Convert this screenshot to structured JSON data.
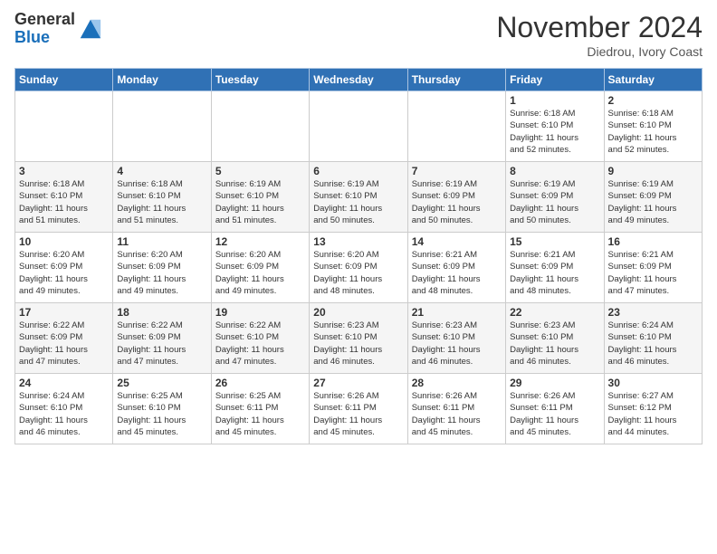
{
  "logo": {
    "general": "General",
    "blue": "Blue"
  },
  "header": {
    "month": "November 2024",
    "location": "Diedrou, Ivory Coast"
  },
  "weekdays": [
    "Sunday",
    "Monday",
    "Tuesday",
    "Wednesday",
    "Thursday",
    "Friday",
    "Saturday"
  ],
  "weeks": [
    [
      {
        "day": "",
        "info": ""
      },
      {
        "day": "",
        "info": ""
      },
      {
        "day": "",
        "info": ""
      },
      {
        "day": "",
        "info": ""
      },
      {
        "day": "",
        "info": ""
      },
      {
        "day": "1",
        "info": "Sunrise: 6:18 AM\nSunset: 6:10 PM\nDaylight: 11 hours\nand 52 minutes."
      },
      {
        "day": "2",
        "info": "Sunrise: 6:18 AM\nSunset: 6:10 PM\nDaylight: 11 hours\nand 52 minutes."
      }
    ],
    [
      {
        "day": "3",
        "info": "Sunrise: 6:18 AM\nSunset: 6:10 PM\nDaylight: 11 hours\nand 51 minutes."
      },
      {
        "day": "4",
        "info": "Sunrise: 6:18 AM\nSunset: 6:10 PM\nDaylight: 11 hours\nand 51 minutes."
      },
      {
        "day": "5",
        "info": "Sunrise: 6:19 AM\nSunset: 6:10 PM\nDaylight: 11 hours\nand 51 minutes."
      },
      {
        "day": "6",
        "info": "Sunrise: 6:19 AM\nSunset: 6:10 PM\nDaylight: 11 hours\nand 50 minutes."
      },
      {
        "day": "7",
        "info": "Sunrise: 6:19 AM\nSunset: 6:09 PM\nDaylight: 11 hours\nand 50 minutes."
      },
      {
        "day": "8",
        "info": "Sunrise: 6:19 AM\nSunset: 6:09 PM\nDaylight: 11 hours\nand 50 minutes."
      },
      {
        "day": "9",
        "info": "Sunrise: 6:19 AM\nSunset: 6:09 PM\nDaylight: 11 hours\nand 49 minutes."
      }
    ],
    [
      {
        "day": "10",
        "info": "Sunrise: 6:20 AM\nSunset: 6:09 PM\nDaylight: 11 hours\nand 49 minutes."
      },
      {
        "day": "11",
        "info": "Sunrise: 6:20 AM\nSunset: 6:09 PM\nDaylight: 11 hours\nand 49 minutes."
      },
      {
        "day": "12",
        "info": "Sunrise: 6:20 AM\nSunset: 6:09 PM\nDaylight: 11 hours\nand 49 minutes."
      },
      {
        "day": "13",
        "info": "Sunrise: 6:20 AM\nSunset: 6:09 PM\nDaylight: 11 hours\nand 48 minutes."
      },
      {
        "day": "14",
        "info": "Sunrise: 6:21 AM\nSunset: 6:09 PM\nDaylight: 11 hours\nand 48 minutes."
      },
      {
        "day": "15",
        "info": "Sunrise: 6:21 AM\nSunset: 6:09 PM\nDaylight: 11 hours\nand 48 minutes."
      },
      {
        "day": "16",
        "info": "Sunrise: 6:21 AM\nSunset: 6:09 PM\nDaylight: 11 hours\nand 47 minutes."
      }
    ],
    [
      {
        "day": "17",
        "info": "Sunrise: 6:22 AM\nSunset: 6:09 PM\nDaylight: 11 hours\nand 47 minutes."
      },
      {
        "day": "18",
        "info": "Sunrise: 6:22 AM\nSunset: 6:09 PM\nDaylight: 11 hours\nand 47 minutes."
      },
      {
        "day": "19",
        "info": "Sunrise: 6:22 AM\nSunset: 6:10 PM\nDaylight: 11 hours\nand 47 minutes."
      },
      {
        "day": "20",
        "info": "Sunrise: 6:23 AM\nSunset: 6:10 PM\nDaylight: 11 hours\nand 46 minutes."
      },
      {
        "day": "21",
        "info": "Sunrise: 6:23 AM\nSunset: 6:10 PM\nDaylight: 11 hours\nand 46 minutes."
      },
      {
        "day": "22",
        "info": "Sunrise: 6:23 AM\nSunset: 6:10 PM\nDaylight: 11 hours\nand 46 minutes."
      },
      {
        "day": "23",
        "info": "Sunrise: 6:24 AM\nSunset: 6:10 PM\nDaylight: 11 hours\nand 46 minutes."
      }
    ],
    [
      {
        "day": "24",
        "info": "Sunrise: 6:24 AM\nSunset: 6:10 PM\nDaylight: 11 hours\nand 46 minutes."
      },
      {
        "day": "25",
        "info": "Sunrise: 6:25 AM\nSunset: 6:10 PM\nDaylight: 11 hours\nand 45 minutes."
      },
      {
        "day": "26",
        "info": "Sunrise: 6:25 AM\nSunset: 6:11 PM\nDaylight: 11 hours\nand 45 minutes."
      },
      {
        "day": "27",
        "info": "Sunrise: 6:26 AM\nSunset: 6:11 PM\nDaylight: 11 hours\nand 45 minutes."
      },
      {
        "day": "28",
        "info": "Sunrise: 6:26 AM\nSunset: 6:11 PM\nDaylight: 11 hours\nand 45 minutes."
      },
      {
        "day": "29",
        "info": "Sunrise: 6:26 AM\nSunset: 6:11 PM\nDaylight: 11 hours\nand 45 minutes."
      },
      {
        "day": "30",
        "info": "Sunrise: 6:27 AM\nSunset: 6:12 PM\nDaylight: 11 hours\nand 44 minutes."
      }
    ]
  ]
}
